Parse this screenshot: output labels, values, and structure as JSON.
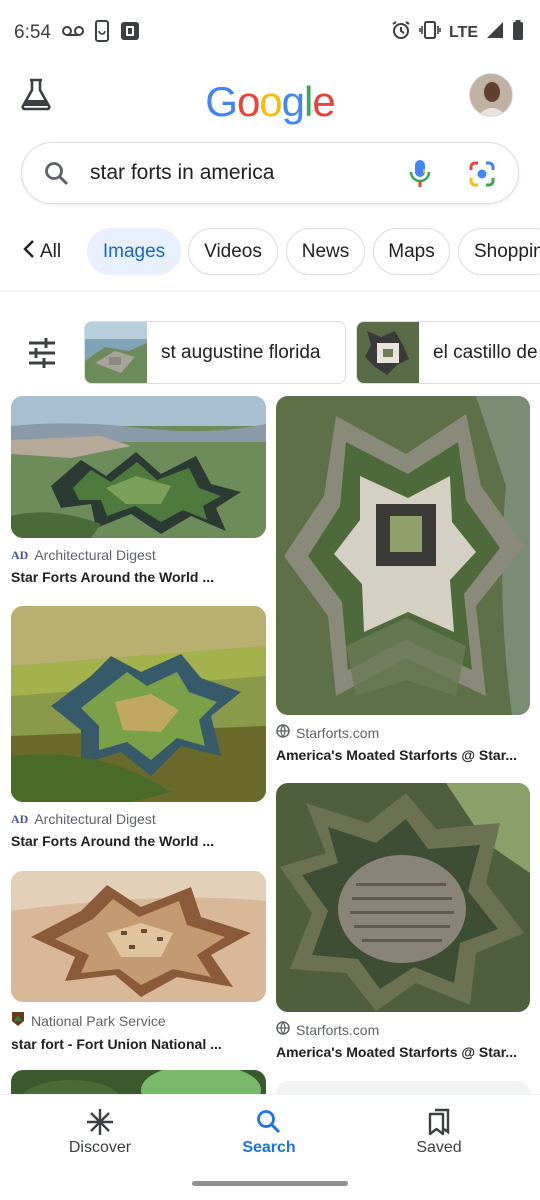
{
  "status_bar": {
    "time": "6:54",
    "network": "LTE",
    "icons": [
      "voicemail-icon",
      "phone-sync-icon",
      "app-notification-icon",
      "alarm-icon",
      "vibrate-icon",
      "signal-icon",
      "battery-icon"
    ]
  },
  "header": {
    "logo_letters": [
      "G",
      "o",
      "o",
      "g",
      "l",
      "e"
    ],
    "logo_colors": [
      "#4285F4",
      "#EA4335",
      "#FBBC05",
      "#4285F4",
      "#34A853",
      "#EA4335"
    ],
    "labs_icon": "flask-icon",
    "avatar": "profile-avatar"
  },
  "search": {
    "query": "star forts in america",
    "icons": [
      "search-icon",
      "microphone-icon",
      "lens-icon"
    ]
  },
  "filters": {
    "back_label": "All",
    "chips": [
      {
        "label": "Images",
        "active": true
      },
      {
        "label": "Videos",
        "active": false
      },
      {
        "label": "News",
        "active": false
      },
      {
        "label": "Maps",
        "active": false
      },
      {
        "label": "Shopping",
        "active": false
      }
    ]
  },
  "related": [
    {
      "label": "st augustine florida"
    },
    {
      "label": "el castillo de"
    }
  ],
  "results": [
    {
      "source": "Architectural Digest",
      "title": "Star Forts Around the World ..."
    },
    {
      "source": "Starforts.com",
      "title": "America's Moated Starforts @ Star..."
    },
    {
      "source": "Architectural Digest",
      "title": "Star Forts Around the World ..."
    },
    {
      "source": "National Park Service",
      "title": "star fort - Fort Union National ..."
    },
    {
      "source": "Starforts.com",
      "title": "America's Moated Starforts @ Star..."
    }
  ],
  "bottom_nav": [
    {
      "label": "Discover",
      "active": false
    },
    {
      "label": "Search",
      "active": true
    },
    {
      "label": "Saved",
      "active": false
    }
  ],
  "colors": {
    "accent": "#1a73e8",
    "chip_active_bg": "#e8f0fe"
  }
}
